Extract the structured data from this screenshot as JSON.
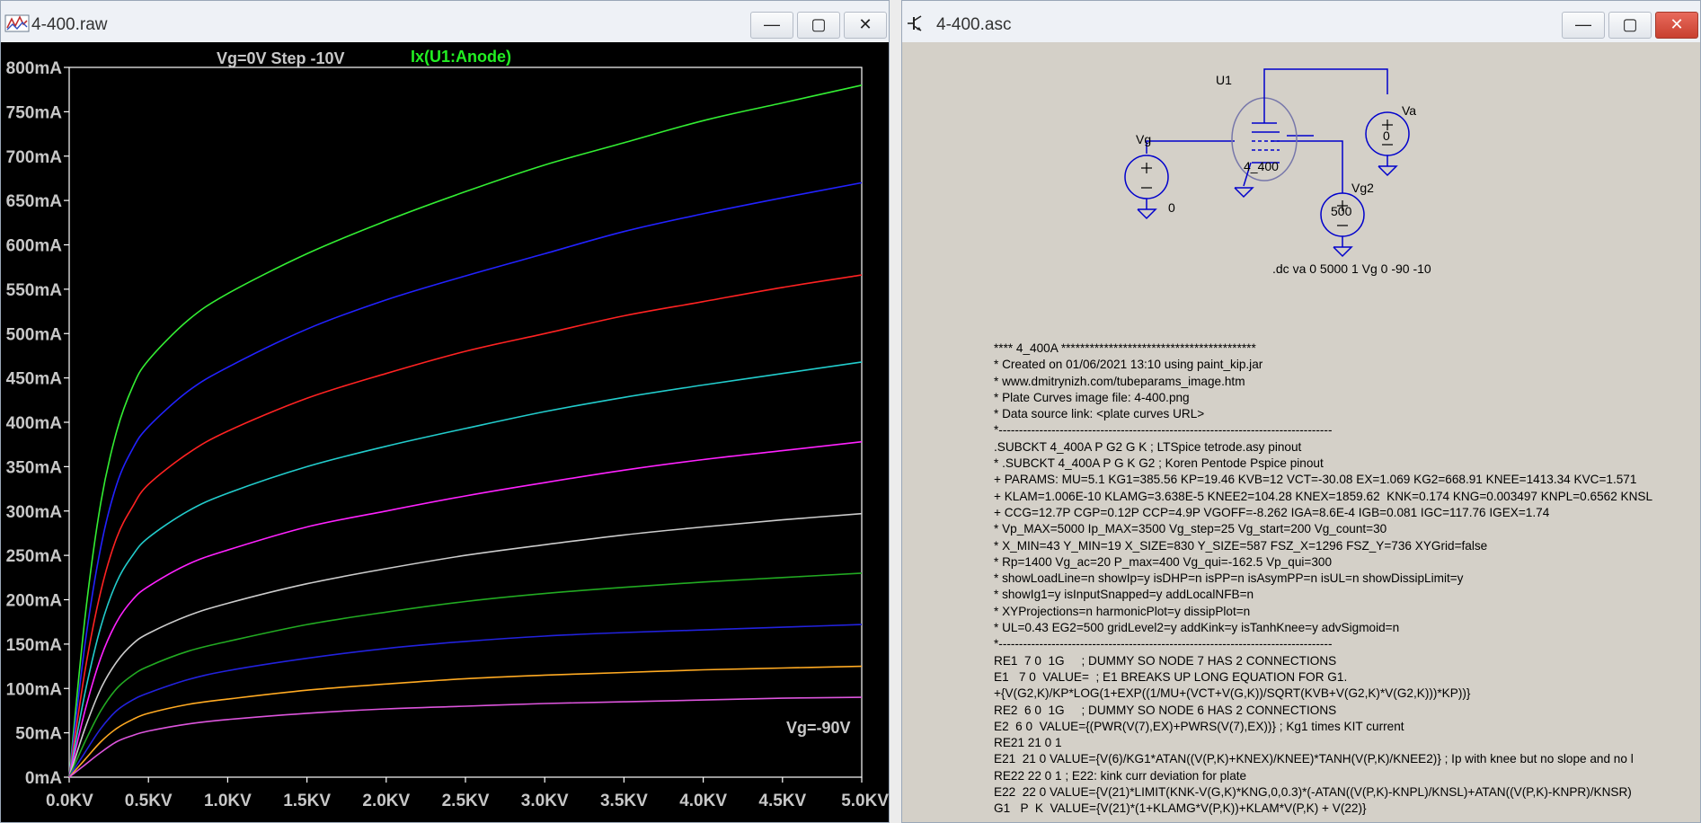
{
  "plot_window": {
    "title": "4-400.raw",
    "minimize_label": "—",
    "maximize_label": "▢",
    "close_label": "✕",
    "step_label": "Vg=0V Step -10V",
    "trace_label": "Ix(U1:Anode)",
    "trace_color": "#22ee22",
    "curve_label": "Vg=-90V",
    "colors": {
      "background": "#000000",
      "axes": "#ffffff",
      "text": "#c8c8c8"
    }
  },
  "chart_data": {
    "type": "line",
    "title": "Vg=0V Step -10V",
    "xlabel": "",
    "ylabel": "",
    "xlim": [
      0,
      5
    ],
    "ylim": [
      0,
      800
    ],
    "grid": false,
    "x_ticks": [
      "0.0KV",
      "0.5KV",
      "1.0KV",
      "1.5KV",
      "2.0KV",
      "2.5KV",
      "3.0KV",
      "3.5KV",
      "4.0KV",
      "4.5KV",
      "5.0KV"
    ],
    "y_ticks": [
      "0mA",
      "50mA",
      "100mA",
      "150mA",
      "200mA",
      "250mA",
      "300mA",
      "350mA",
      "400mA",
      "450mA",
      "500mA",
      "550mA",
      "600mA",
      "650mA",
      "700mA",
      "750mA",
      "800mA"
    ],
    "x": [
      0,
      0.1,
      0.2,
      0.3,
      0.4,
      0.5,
      0.75,
      1.0,
      1.5,
      2.0,
      2.5,
      3.0,
      3.5,
      4.0,
      4.5,
      5.0
    ],
    "series": [
      {
        "color": "#33ee33",
        "values": [
          0,
          180,
          310,
          390,
          440,
          470,
          515,
          545,
          590,
          627,
          660,
          690,
          715,
          740,
          760,
          780
        ]
      },
      {
        "color": "#2222ff",
        "values": [
          0,
          150,
          260,
          330,
          370,
          395,
          435,
          462,
          505,
          538,
          565,
          590,
          615,
          635,
          653,
          670
        ]
      },
      {
        "color": "#ff2222",
        "values": [
          0,
          120,
          210,
          270,
          305,
          330,
          365,
          390,
          427,
          455,
          480,
          500,
          520,
          536,
          552,
          566
        ]
      },
      {
        "color": "#22cccc",
        "values": [
          0,
          95,
          170,
          220,
          250,
          270,
          300,
          320,
          350,
          373,
          393,
          412,
          428,
          442,
          455,
          468
        ]
      },
      {
        "color": "#ff22ff",
        "values": [
          0,
          75,
          135,
          175,
          200,
          215,
          240,
          256,
          282,
          300,
          317,
          332,
          346,
          358,
          368,
          378
        ]
      },
      {
        "color": "#cccccc",
        "values": [
          0,
          55,
          100,
          130,
          150,
          162,
          182,
          196,
          218,
          235,
          250,
          262,
          273,
          282,
          290,
          297
        ]
      },
      {
        "color": "#22aa22",
        "values": [
          0,
          40,
          75,
          100,
          115,
          125,
          142,
          153,
          172,
          186,
          198,
          207,
          214,
          220,
          225,
          230
        ]
      },
      {
        "color": "#2222dd",
        "values": [
          0,
          28,
          55,
          75,
          87,
          95,
          110,
          120,
          134,
          145,
          153,
          159,
          163,
          166,
          169,
          172
        ]
      },
      {
        "color": "#ffaa22",
        "values": [
          0,
          20,
          40,
          55,
          65,
          72,
          82,
          88,
          98,
          105,
          111,
          115,
          118,
          121,
          123,
          125
        ]
      },
      {
        "color": "#dd55dd",
        "values": [
          0,
          14,
          28,
          40,
          47,
          52,
          60,
          65,
          72,
          77,
          80,
          83,
          85,
          87,
          89,
          90
        ]
      }
    ]
  },
  "schematic_window": {
    "title": "4-400.asc",
    "minimize_label": "—",
    "maximize_label": "▢",
    "close_label": "✕",
    "background": "#d4d0c8",
    "components": {
      "u1": "U1",
      "tube_model": "4_400",
      "va": "Va",
      "va_value": "0",
      "vg": "Vg",
      "vg_value": "0",
      "vg2": "Vg2",
      "vg2_value": "500"
    },
    "directive": ".dc va 0 5000 1 Vg 0 -90 -10",
    "netlist": [
      "**** 4_400A *****************************************",
      "* Created on 01/06/2021 13:10 using paint_kip.jar",
      "* www.dmitrynizh.com/tubeparams_image.htm",
      "* Plate Curves image file: 4-400.png",
      "* Data source link: <plate curves URL>",
      "*----------------------------------------------------------------------------------",
      ".SUBCKT 4_400A P G2 G K ; LTSpice tetrode.asy pinout",
      "* .SUBCKT 4_400A P G K G2 ; Koren Pentode Pspice pinout",
      "+ PARAMS: MU=5.1 KG1=385.56 KP=19.46 KVB=12 VCT=-30.08 EX=1.069 KG2=668.91 KNEE=1413.34 KVC=1.571",
      "+ KLAM=1.006E-10 KLAMG=3.638E-5 KNEE2=104.28 KNEX=1859.62  KNK=0.174 KNG=0.003497 KNPL=0.6562 KNSL",
      "+ CCG=12.7P CGP=0.12P CCP=4.9P VGOFF=-8.262 IGA=8.6E-4 IGB=0.081 IGC=117.76 IGEX=1.74",
      "* Vp_MAX=5000 Ip_MAX=3500 Vg_step=25 Vg_start=200 Vg_count=30",
      "* X_MIN=43 Y_MIN=19 X_SIZE=830 Y_SIZE=587 FSZ_X=1296 FSZ_Y=736 XYGrid=false",
      "* Rp=1400 Vg_ac=20 P_max=400 Vg_qui=-162.5 Vp_qui=300",
      "* showLoadLine=n showIp=y isDHP=n isPP=n isAsymPP=n isUL=n showDissipLimit=y",
      "* showIg1=y isInputSnapped=y addLocalNFB=n",
      "* XYProjections=n harmonicPlot=y dissipPlot=n",
      "* UL=0.43 EG2=500 gridLevel2=y addKink=y isTanhKnee=y advSigmoid=n",
      "*----------------------------------------------------------------------------------",
      "RE1  7 0  1G     ; DUMMY SO NODE 7 HAS 2 CONNECTIONS",
      "E1   7 0  VALUE=  ; E1 BREAKS UP LONG EQUATION FOR G1.",
      "+{V(G2,K)/KP*LOG(1+EXP((1/MU+(VCT+V(G,K))/SQRT(KVB+V(G2,K)*V(G2,K)))*KP))}",
      "RE2  6 0  1G     ; DUMMY SO NODE 6 HAS 2 CONNECTIONS",
      "E2  6 0  VALUE={(PWR(V(7),EX)+PWRS(V(7),EX))} ; Kg1 times KIT current",
      "RE21 21 0 1",
      "E21  21 0 VALUE={V(6)/KG1*ATAN((V(P,K)+KNEX)/KNEE)*TANH(V(P,K)/KNEE2)} ; Ip with knee but no slope and no l",
      "RE22 22 0 1 ; E22: kink curr deviation for plate",
      "E22  22 0 VALUE={V(21)*LIMIT(KNK-V(G,K)*KNG,0,0.3)*(-ATAN((V(P,K)-KNPL)/KNSL)+ATAN((V(P,K)-KNPR)/KNSR)",
      "G1   P  K  VALUE={V(21)*(1+KLAMG*V(P,K))+KLAM*V(P,K) + V(22)}"
    ]
  }
}
